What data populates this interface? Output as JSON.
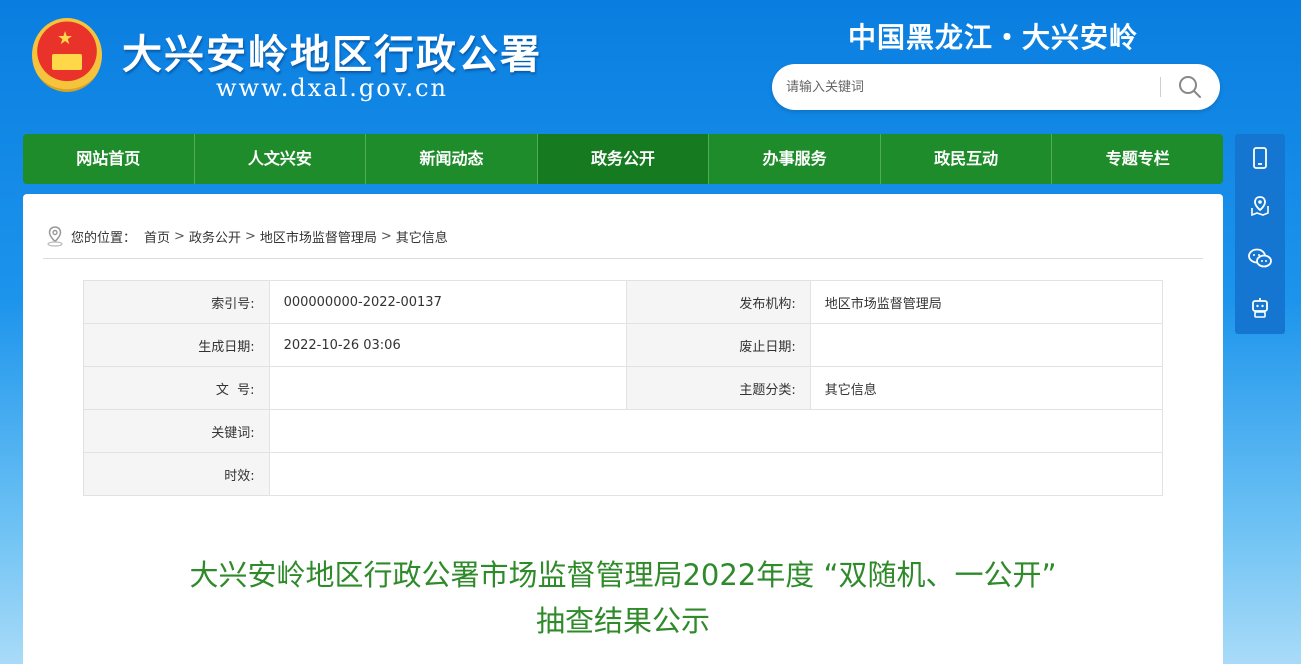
{
  "header": {
    "site_title": "大兴安岭地区行政公署",
    "site_url": "www.dxal.gov.cn",
    "region_title": "中国黑龙江・大兴安岭",
    "search_placeholder": "请输入关键词",
    "emblem_star": "★"
  },
  "nav": {
    "items": [
      "网站首页",
      "人文兴安",
      "新闻动态",
      "政务公开",
      "办事服务",
      "政民互动",
      "专题专栏"
    ],
    "active_index": 3
  },
  "side_toolbar": {
    "icons": [
      "mobile-icon",
      "map-pin-icon",
      "wechat-icon",
      "robot-icon"
    ]
  },
  "breadcrumb": {
    "prefix": "您的位置：",
    "items": [
      "首页",
      "政务公开",
      "地区市场监督管理局",
      "其它信息"
    ],
    "sep": ">"
  },
  "meta": {
    "index_label": "索引号:",
    "index_value": "000000000-2022-00137",
    "publisher_label": "发布机构:",
    "publisher_value": "地区市场监督管理局",
    "created_label": "生成日期:",
    "created_value": "2022-10-26 03:06",
    "expiry_label": "废止日期:",
    "expiry_value": "",
    "docno_label": "文  号:",
    "docno_value": "",
    "topic_label": "主题分类:",
    "topic_value": "其它信息",
    "keywords_label": "关键词:",
    "keywords_value": "",
    "validity_label": "时效:",
    "validity_value": ""
  },
  "article": {
    "title_line1": "大兴安岭地区行政公署市场监督管理局2022年度 “双随机、一公开”",
    "title_line2": "抽查结果公示"
  },
  "colors": {
    "nav_green": "#1e8c2a",
    "title_green": "#2f8a2a",
    "side_blue": "#1476d0"
  }
}
